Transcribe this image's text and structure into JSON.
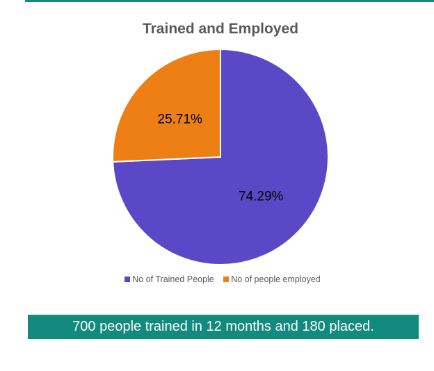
{
  "chart_data": {
    "type": "pie",
    "title": "Trained and Employed",
    "series": [
      {
        "name": "No of Trained People",
        "value": 74.29,
        "label": "74.29%",
        "color": "#5b48c6"
      },
      {
        "name": "No of people employed",
        "value": 25.71,
        "label": "25.71%",
        "color": "#ee7f14"
      }
    ],
    "legend_position": "bottom"
  },
  "caption": "700 people trained in 12 months and 180 placed.",
  "colors": {
    "accent": "#138a7e"
  }
}
